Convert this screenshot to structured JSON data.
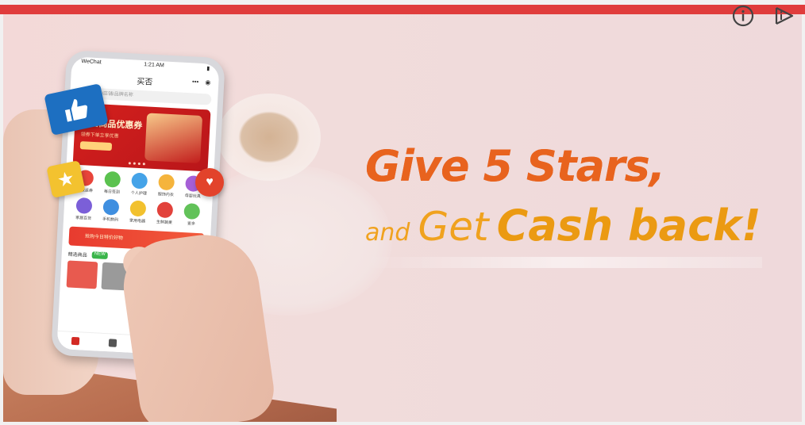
{
  "ad": {
    "headline_line1": "Give 5 Stars,",
    "headline_and": "and",
    "headline_get": "Get",
    "headline_cash": "Cash back!",
    "accent_color": "#e03c3c",
    "headline_orange": "#e8631e",
    "headline_yellow": "#f0a21e"
  },
  "controls": {
    "info_icon": "info-icon",
    "adchoices_icon": "adchoices-play-icon"
  },
  "phone": {
    "status_carrier": "WeChat",
    "status_time": "1:21 AM",
    "app_title": "买否",
    "search_placeholder": "搜索商品/店铺/品牌名称",
    "promo_title": "好店商品优惠券",
    "promo_subtitle": "领券下单立享优惠",
    "grid_labels": [
      "领取返券",
      "每日签到",
      "个人护理",
      "服饰内衣",
      "母婴玩具",
      "家居百货",
      "手机数码",
      "家用电器",
      "生鲜蔬果",
      "更多"
    ],
    "coupon_text": "抢购今日特价好物",
    "section_title": "精选商品",
    "section_badge": "NEW"
  }
}
